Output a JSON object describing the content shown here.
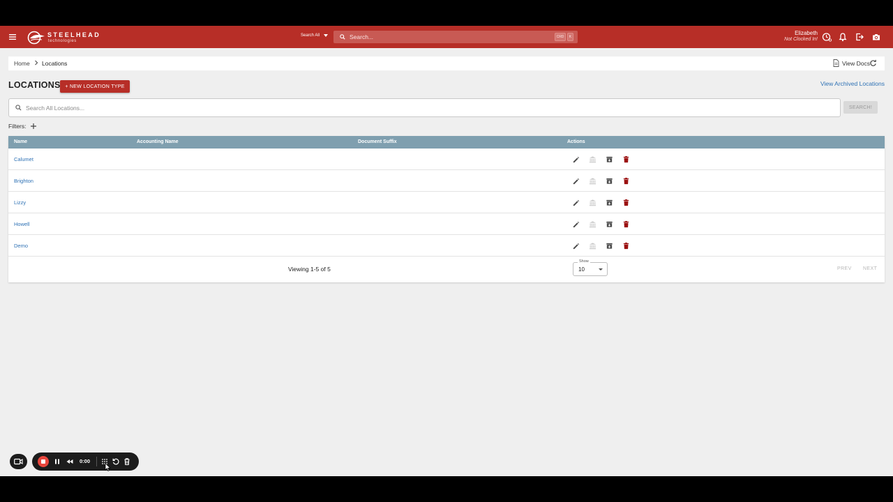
{
  "appbar": {
    "brand_word": "STEELHEAD",
    "brand_sub": "technologies",
    "search_scope": "Search All",
    "search_placeholder": "Search...",
    "kbd_1": "CRD",
    "kbd_2": "K",
    "user_name": "Elizabeth",
    "user_status": "Not Clocked In!",
    "colors": {
      "bar": "#b72e27",
      "accent_blue": "#2f72b5"
    },
    "icons": [
      "menu-icon",
      "clock-icon",
      "bell-icon",
      "logout-icon",
      "camera-icon"
    ]
  },
  "breadcrumb": {
    "home": "Home",
    "current": "Locations",
    "view_docs": "View Docs"
  },
  "page": {
    "title": "LOCATIONS",
    "new_button": "+ NEW LOCATION TYPE",
    "archived_link": "View Archived Locations",
    "search_placeholder": "Search All Locations...",
    "search_button": "SEARCH!",
    "filters_label": "Filters:"
  },
  "table": {
    "columns": [
      "Name",
      "Accounting Name",
      "Document Suffix",
      "Actions"
    ],
    "rows": [
      {
        "name": "Calumet",
        "accounting_name": "",
        "document_suffix": ""
      },
      {
        "name": "Brighton",
        "accounting_name": "",
        "document_suffix": ""
      },
      {
        "name": "Lizzy",
        "accounting_name": "",
        "document_suffix": ""
      },
      {
        "name": "Howell",
        "accounting_name": "",
        "document_suffix": ""
      },
      {
        "name": "Demo",
        "accounting_name": "",
        "document_suffix": ""
      }
    ],
    "action_icons": [
      "edit-icon",
      "bank-icon",
      "archive-icon",
      "delete-icon"
    ],
    "footer": {
      "viewing": "Viewing 1-5 of 5",
      "show_label": "Show",
      "show_value": "10",
      "prev": "PREV",
      "next": "NEXT"
    }
  },
  "recorder": {
    "time": "0:00",
    "icons": [
      "video-camera-icon",
      "stop-icon",
      "pause-icon",
      "rewind-icon",
      "grid-icon",
      "restart-icon",
      "trash-icon"
    ]
  }
}
